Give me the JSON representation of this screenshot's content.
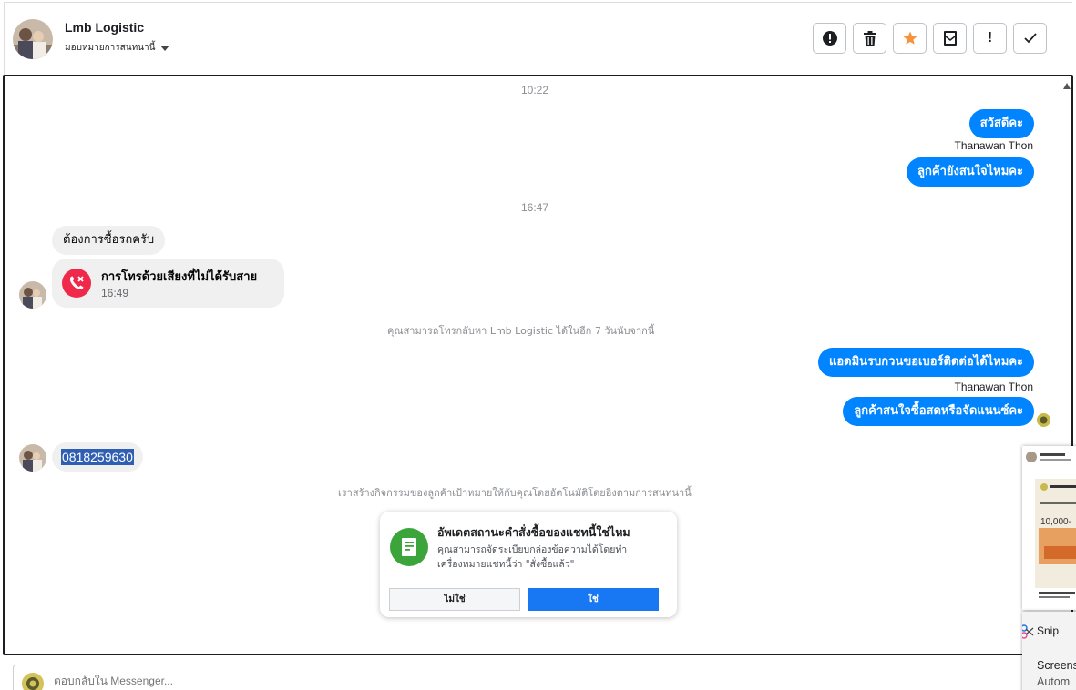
{
  "header": {
    "page_name": "Lmb Logistic",
    "assign_label": "มอบหมายการสนทนานี้",
    "toolbar": [
      {
        "name": "report-button",
        "icon": "alert-circle-icon",
        "glyph": ""
      },
      {
        "name": "delete-button",
        "icon": "trash-icon",
        "glyph": ""
      },
      {
        "name": "star-button",
        "icon": "star-icon",
        "glyph": ""
      },
      {
        "name": "mark-unread-button",
        "icon": "envelope-icon",
        "glyph": ""
      },
      {
        "name": "follow-up-button",
        "icon": "exclamation-icon",
        "glyph": "!"
      },
      {
        "name": "done-button",
        "icon": "check-icon",
        "glyph": "✓"
      }
    ]
  },
  "conversation": {
    "time_1": "10:22",
    "msg_out_1": "สวัสดีคะ",
    "sender_1": "Thanawan Thon",
    "msg_out_2": "ลูกค้ายังสนใจไหมคะ",
    "time_2": "16:47",
    "msg_in_1": "ต้องการซื้อรถครับ",
    "missed_call": {
      "title": "การโทรด้วยเสียงที่ไม่ได้รับสาย",
      "time": "16:49"
    },
    "callback_note": "คุณสามารถโทรกลับหา Lmb Logistic ได้ในอีก 7 วันนับจากนี้",
    "msg_out_3": "แอดมินรบกวนขอเบอร์ติดต่อได้ไหมคะ",
    "sender_2": "Thanawan Thon",
    "msg_out_4": "ลูกค้าสนใจซื้อสดหรือจัดแนนซ์คะ",
    "msg_in_phone": "0818259630",
    "activity_note": "เราสร้างกิจกรรมของลูกค้าเป้าหมายให้กับคุณโดยอัตโนมัติโดยอิงตามการสนทนานี้"
  },
  "order_prompt": {
    "title": "อัพเดตสถานะคำสั่งซื้อของแชทนี้ใช่ไหม",
    "description": "คุณสามารถจัดระเบียบกล่องข้อความได้โดยทำเครื่องหมายแชทนี้ว่า \"สั่งซื้อแล้ว\"",
    "no_label": "ไม่ใช่",
    "yes_label": "ใช่"
  },
  "reply": {
    "placeholder": "ตอบกลับใน Messenger..."
  },
  "overlay": {
    "snip_app": "Snip",
    "snip_title": "Screens",
    "snip_sub": "Autom",
    "thumb_price": "10,000-"
  },
  "colors": {
    "outgoing_bubble": "#0084ff",
    "incoming_bubble": "#f0f0f0",
    "missed_call": "#f0284a",
    "primary_button": "#1877f2",
    "order_icon": "#3ba43b",
    "star": "#f7923b"
  }
}
